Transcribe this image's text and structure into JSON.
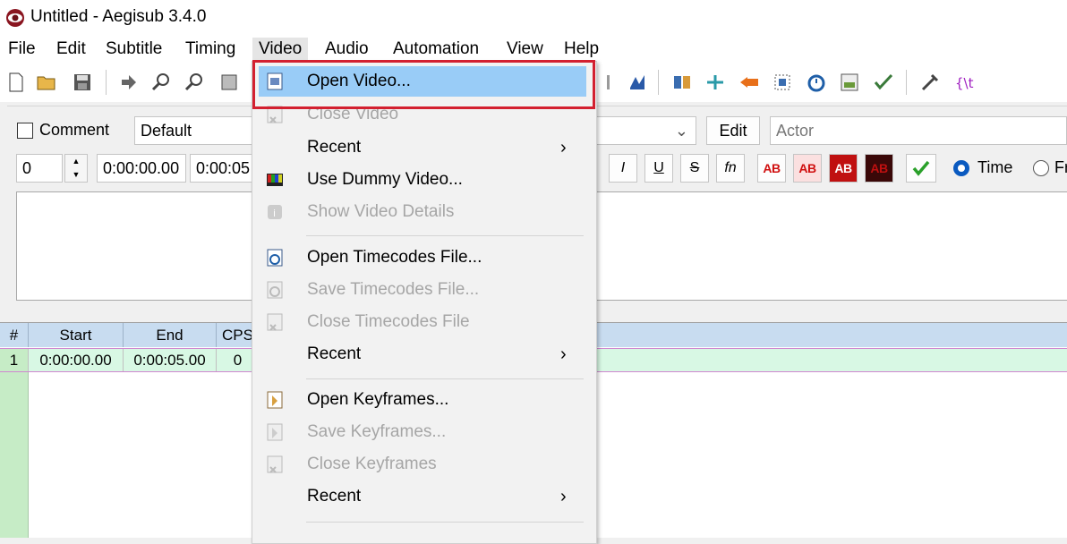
{
  "window": {
    "title": "Untitled - Aegisub 3.4.0",
    "app_icon": "aegisub-eye-icon"
  },
  "menubar": {
    "items": [
      "File",
      "Edit",
      "Subtitle",
      "Timing",
      "Video",
      "Audio",
      "Automation",
      "View",
      "Help"
    ],
    "active": "Video"
  },
  "edit_panel": {
    "comment_label": "Comment",
    "style_value": "Default",
    "edit_button": "Edit",
    "actor_placeholder": "Actor",
    "layer_value": "0",
    "start_time": "0:00:00.00",
    "end_time": "0:00:05",
    "format_buttons": [
      "I",
      "U",
      "S",
      "fn",
      "AB",
      "AB",
      "AB",
      "AB"
    ],
    "commit_icon": "checkmark-icon",
    "time_radio_label": "Time",
    "frame_radio_label": "Fr"
  },
  "grid": {
    "columns": [
      "#",
      "Start",
      "End",
      "CPS"
    ],
    "rows": [
      {
        "num": "1",
        "start": "0:00:00.00",
        "end": "0:00:05.00",
        "cps": "0"
      }
    ]
  },
  "video_menu": {
    "items": [
      {
        "label": "Open Video...",
        "icon": "open-video-icon",
        "enabled": true,
        "highlighted": true
      },
      {
        "label": "Close Video",
        "icon": "close-video-icon",
        "enabled": false
      },
      {
        "label": "Recent",
        "submenu": true,
        "enabled": true
      },
      {
        "label": "Use Dummy Video...",
        "icon": "dummy-video-icon",
        "enabled": true
      },
      {
        "label": "Show Video Details",
        "icon": "video-details-icon",
        "enabled": false
      },
      {
        "label": "Open Timecodes File...",
        "icon": "open-timecodes-icon",
        "enabled": true
      },
      {
        "label": "Save Timecodes File...",
        "icon": "save-timecodes-icon",
        "enabled": false
      },
      {
        "label": "Close Timecodes File",
        "icon": "close-timecodes-icon",
        "enabled": false
      },
      {
        "label": "Recent",
        "submenu": true,
        "enabled": true
      },
      {
        "label": "Open Keyframes...",
        "icon": "open-keyframes-icon",
        "enabled": true
      },
      {
        "label": "Save Keyframes...",
        "icon": "save-keyframes-icon",
        "enabled": false
      },
      {
        "label": "Close Keyframes",
        "icon": "close-keyframes-icon",
        "enabled": false
      },
      {
        "label": "Recent",
        "submenu": true,
        "enabled": true
      }
    ],
    "submenu_arrow": "›"
  },
  "colors": {
    "highlight": "#99ccf7",
    "annotation_box": "#d32030",
    "grid_header": "#c8dcf0",
    "active_row": "#d8f8e4"
  }
}
